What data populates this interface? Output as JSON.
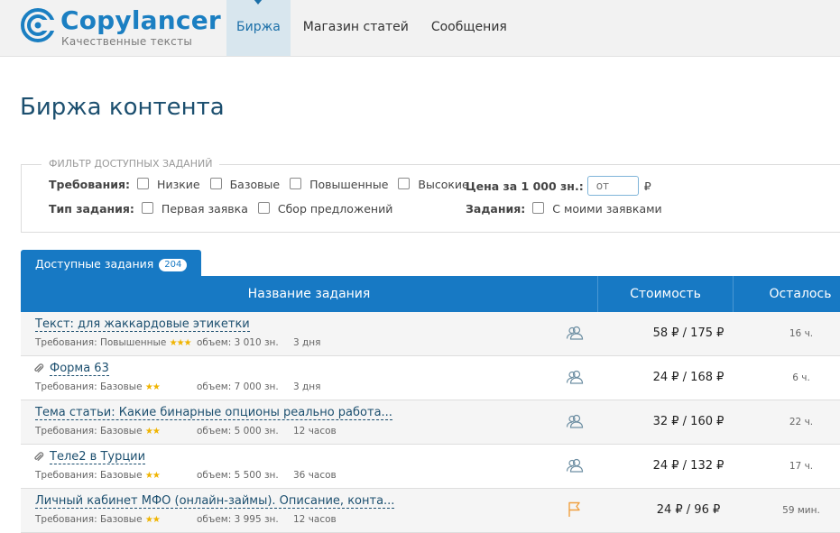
{
  "header": {
    "logo_name": "Copylancer",
    "logo_tagline": "Качественные тексты",
    "nav": [
      {
        "label": "Биржа",
        "active": true
      },
      {
        "label": "Магазин статей",
        "active": false
      },
      {
        "label": "Сообщения",
        "active": false
      }
    ]
  },
  "page_title": "Биржа контента",
  "filter": {
    "legend": "ФИЛЬТР ДОСТУПНЫХ ЗАДАНИЙ",
    "requirements_label": "Требования:",
    "requirements_options": [
      "Низкие",
      "Базовые",
      "Повышенные",
      "Высокие"
    ],
    "task_type_label": "Тип задания:",
    "task_type_options": [
      "Первая заявка",
      "Сбор предложений"
    ],
    "price_label": "Цена за 1 000 зн.:",
    "price_placeholder": "от",
    "price_currency": "₽",
    "tasks_label": "Задания:",
    "tasks_option": "С моими заявками"
  },
  "tab": {
    "label": "Доступные задания",
    "count": "204"
  },
  "table": {
    "columns": [
      "Название задания",
      "Стоимость",
      "Осталось"
    ],
    "rows": [
      {
        "title": "Текст: для жаккардовые этикетки",
        "attachment": false,
        "requirements": "Требования: Повышенные",
        "stars": 3,
        "volume": "объем: 3 010 зн.",
        "duration": "3 дня",
        "icon": "users-icon",
        "price": "58 ₽ / 175 ₽",
        "left": "16 ч."
      },
      {
        "title": "Форма 63",
        "attachment": true,
        "requirements": "Требования: Базовые",
        "stars": 2,
        "volume": "объем: 7 000 зн.",
        "duration": "3 дня",
        "icon": "users-icon",
        "price": "24 ₽ / 168 ₽",
        "left": "6 ч."
      },
      {
        "title": "Тема статьи: Какие бинарные опционы реально работа...",
        "attachment": false,
        "requirements": "Требования: Базовые",
        "stars": 2,
        "volume": "объем: 5 000 зн.",
        "duration": "12 часов",
        "icon": "users-icon",
        "price": "32 ₽ / 160 ₽",
        "left": "22 ч."
      },
      {
        "title": "Теле2 в Турции",
        "attachment": true,
        "requirements": "Требования: Базовые",
        "stars": 2,
        "volume": "объем: 5 500 зн.",
        "duration": "36 часов",
        "icon": "users-icon",
        "price": "24 ₽ / 132 ₽",
        "left": "17 ч."
      },
      {
        "title": "Личный кабинет МФО (онлайн-займы). Описание, конта...",
        "attachment": false,
        "requirements": "Требования: Базовые",
        "stars": 2,
        "volume": "объем: 3 995 зн.",
        "duration": "12 часов",
        "icon": "flag-icon",
        "price": "24 ₽ / 96 ₽",
        "left": "59 мин."
      }
    ]
  },
  "colors": {
    "brand": "#1b7fc2",
    "table_header": "#1779c4",
    "star": "#f0b400",
    "flag": "#f0a040"
  }
}
